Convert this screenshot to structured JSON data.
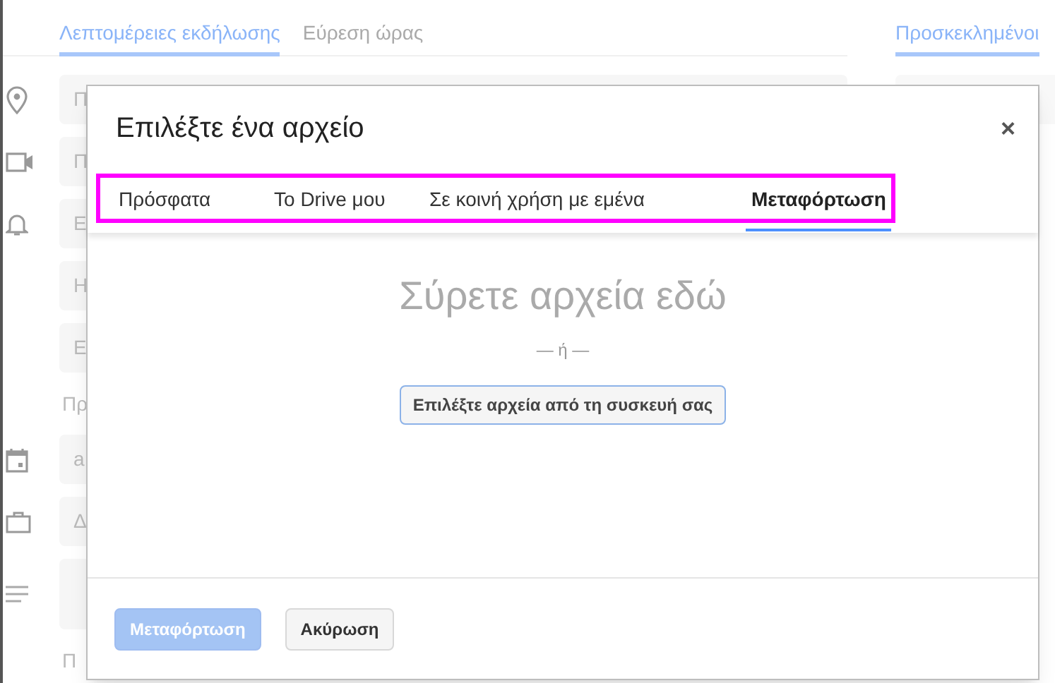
{
  "page": {
    "tabs": [
      {
        "label": "Λεπτομέρειες εκδήλωσης",
        "selected": true
      },
      {
        "label": "Εύρεση ώρας",
        "selected": false
      }
    ],
    "side_tab": {
      "label": "Προσκεκλημένοι",
      "selected": true
    },
    "rows": [
      {
        "kind": "field",
        "text": "Π"
      },
      {
        "kind": "field",
        "text": "Π"
      },
      {
        "kind": "field",
        "text": "Ε"
      },
      {
        "kind": "field",
        "text": "Η"
      },
      {
        "kind": "field",
        "text": "Ε"
      },
      {
        "kind": "label",
        "text": "Πρ"
      },
      {
        "kind": "field",
        "text": "a"
      },
      {
        "kind": "field",
        "text": "Δ"
      },
      {
        "kind": "tallfield"
      },
      {
        "kind": "label",
        "text": "Π"
      }
    ]
  },
  "dialog": {
    "title": "Επιλέξτε ένα αρχείο",
    "close": "×",
    "tabs_highlighted": true,
    "tabs": [
      {
        "label": "Πρόσφατα",
        "selected": false
      },
      {
        "label": "Το Drive μου",
        "selected": false
      },
      {
        "label": "Σε κοινή χρήση με εμένα",
        "selected": false
      },
      {
        "label": "Μεταφόρτωση",
        "selected": true
      }
    ],
    "drop_text": "Σύρετε αρχεία εδώ",
    "or_text": "— ή —",
    "select_button": "Επιλέξτε αρχεία από τη συσκευή σας",
    "buttons": [
      {
        "label": "Μεταφόρτωση",
        "kind": "primary",
        "disabled": true
      },
      {
        "label": "Ακύρωση",
        "kind": "secondary",
        "disabled": false
      }
    ]
  }
}
